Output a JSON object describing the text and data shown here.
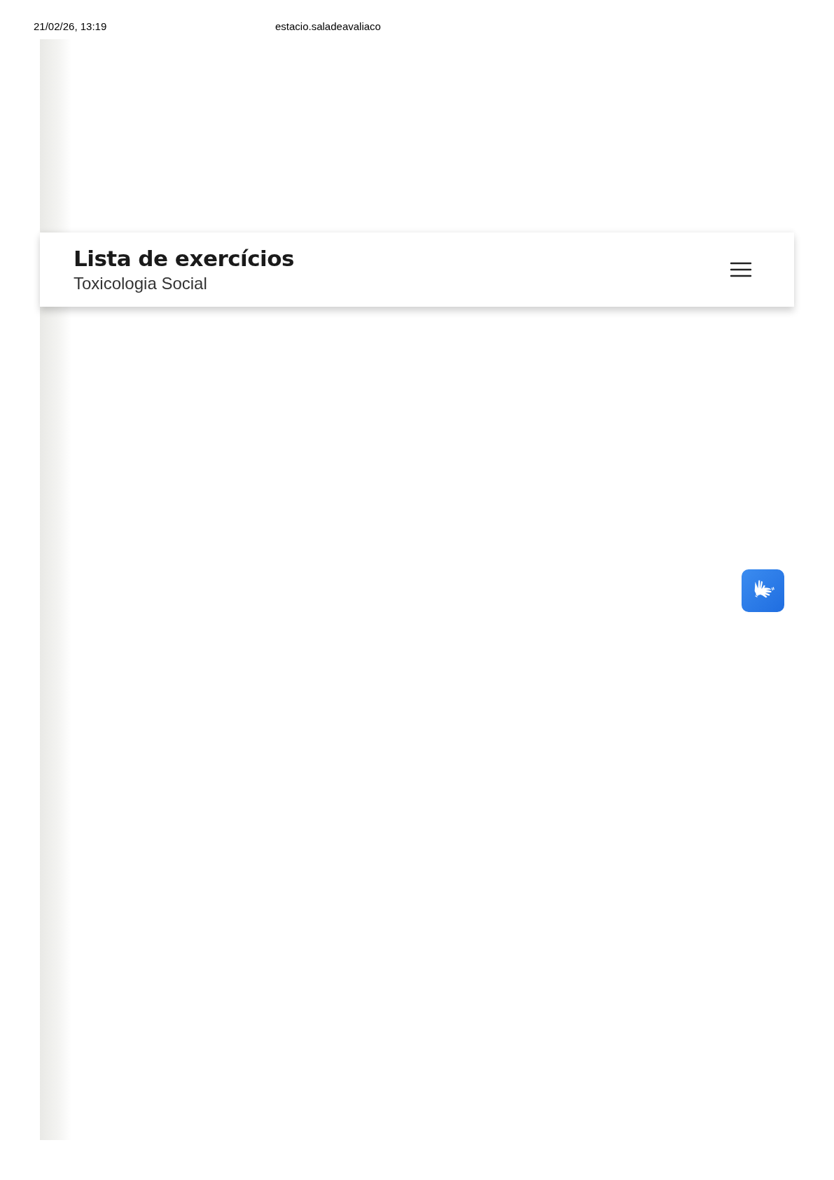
{
  "print_header": {
    "date": "21/02/26, 13:19",
    "url": "estacio.saladeavaliaco"
  },
  "header": {
    "title": "Lista de exercícios",
    "subtitle": "Toxicologia Social"
  }
}
